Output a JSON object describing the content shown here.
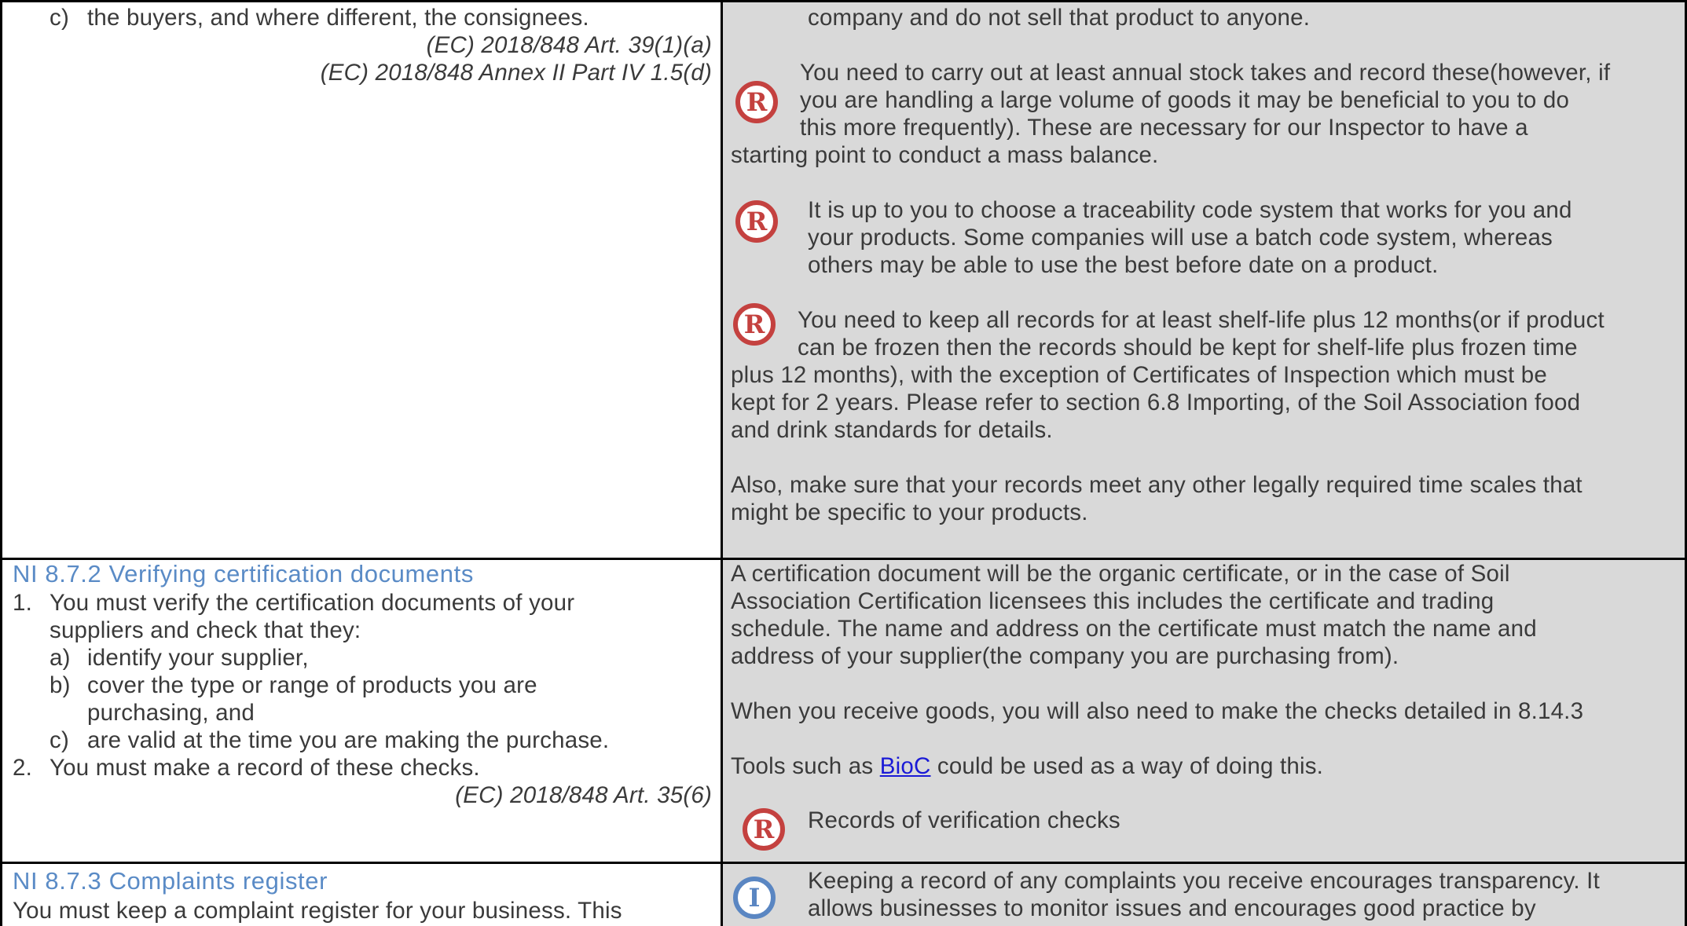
{
  "colors": {
    "heading_blue": "#5a8bc6",
    "record_badge_red": "#c4413f",
    "info_badge_blue": "#5a86c2",
    "link_blue": "#1a1ad6",
    "guidance_bg": "#d9d9d9"
  },
  "row1": {
    "left": {
      "item_c_marker": "c)",
      "item_c_text": "the buyers, and where different, the consignees.",
      "ref1": "(EC) 2018/848 Art. 39(1)(a)",
      "ref2": "(EC) 2018/848 Annex II Part IV 1.5(d)"
    },
    "right": {
      "cont_line": "company and do not sell that product to anyone.",
      "badge_letter": "R",
      "block1": [
        "You need to carry out at least annual stock takes and record these(however, if",
        "you are handling a large volume of goods it may be beneficial to you to do",
        "this more frequently). These are necessary for our Inspector to have a",
        "starting point to conduct a mass balance."
      ],
      "block2": [
        "It is up to you to choose a traceability code system that works for you and",
        "your products.  Some companies will use a batch code system, whereas",
        "others may be able to use the best before date on a product."
      ],
      "block3": [
        "You need to keep all records for at least shelf-life plus 12 months(or if product",
        "can be frozen then the records should be kept for shelf-life plus frozen time",
        "plus 12 months), with the exception of Certificates of Inspection which must be",
        "kept for 2 years. Please refer to section 6.8 Importing, of the Soil Association food",
        "and drink standards for details."
      ],
      "block4": [
        "Also, make sure that your records meet any other legally required time scales that",
        "might be specific to your products."
      ]
    }
  },
  "row2": {
    "left": {
      "heading": "NI 8.7.2 Verifying certification documents",
      "item1_marker": "1.",
      "item1_lines": [
        "You must verify the certification documents of your",
        "suppliers and check that they:"
      ],
      "sub_a_marker": "a)",
      "sub_a": "identify your supplier,",
      "sub_b_marker": "b)",
      "sub_b_lines": [
        "cover the type or range of products you are",
        "purchasing, and"
      ],
      "sub_c_marker": "c)",
      "sub_c": "are valid at the time you are making the purchase.",
      "item2_marker": "2.",
      "item2": "You must make a record of these checks.",
      "ref": "(EC) 2018/848 Art. 35(6)"
    },
    "right": {
      "para1": [
        "A certification document will be the organic certificate, or in the case of Soil",
        "Association Certification licensees this includes the certificate and trading",
        "schedule. The name and address on the certificate must match the name and",
        "address of your supplier(the company you are purchasing from)."
      ],
      "para2": "When you receive goods, you will also need to make the checks detailed in 8.14.3",
      "tools_prefix": "Tools such as ",
      "tools_link": "BioC",
      "tools_suffix": " could be used as a way of doing this.",
      "badge_letter": "R",
      "record_note": "Records of verification checks"
    }
  },
  "row3": {
    "left": {
      "heading": "NI 8.7.3 Complaints register",
      "text": "You must keep a complaint register for your business. This"
    },
    "right": {
      "badge_letter": "I",
      "lines": [
        "Keeping a record of any complaints you receive encourages transparency. It",
        "allows businesses to monitor issues and encourages good practice by"
      ]
    }
  }
}
